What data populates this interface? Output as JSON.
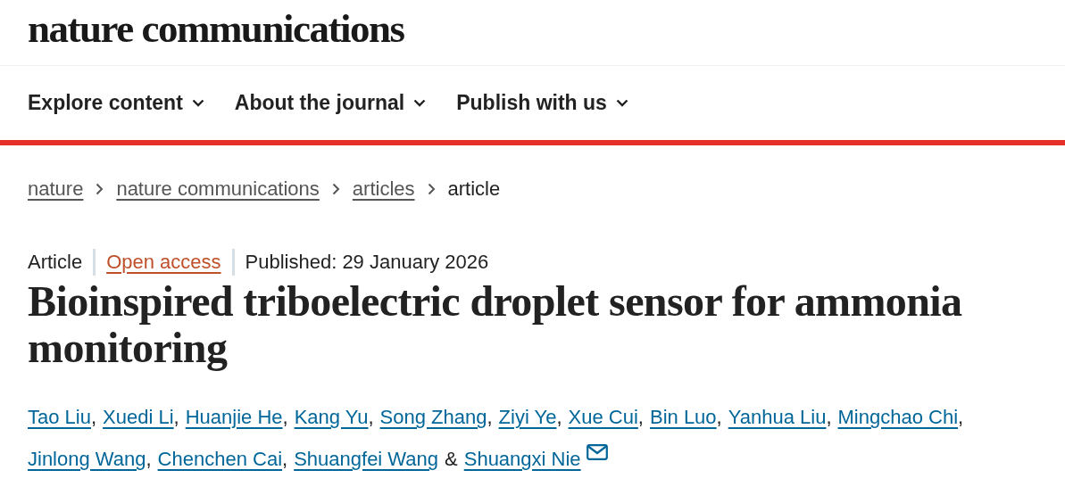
{
  "header": {
    "logo": "nature communications"
  },
  "nav": [
    {
      "label": "Explore content",
      "expanded": false
    },
    {
      "label": "About the journal",
      "expanded": false
    },
    {
      "label": "Publish with us",
      "expanded": false
    }
  ],
  "breadcrumb": [
    {
      "label": "nature",
      "current": false
    },
    {
      "label": "nature communications",
      "current": false
    },
    {
      "label": "articles",
      "current": false
    },
    {
      "label": "article",
      "current": true
    }
  ],
  "meta": [
    {
      "text": "Article",
      "kind": "type"
    },
    {
      "text": "Open access",
      "kind": "access"
    },
    {
      "text": "Published: 29 January 2026",
      "kind": "date"
    }
  ],
  "title": "Bioinspired triboelectric droplet sensor for ammonia monitoring",
  "author_lines": [
    [
      {
        "name": "Tao Liu",
        "separator": ",",
        "corresponding": false
      },
      {
        "name": "Xuedi Li",
        "separator": ",",
        "corresponding": false
      },
      {
        "name": "Huanjie He",
        "separator": ",",
        "corresponding": false
      },
      {
        "name": "Kang Yu",
        "separator": ",",
        "corresponding": false
      },
      {
        "name": "Song Zhang",
        "separator": ",",
        "corresponding": false
      },
      {
        "name": "Ziyi Ye",
        "separator": ",",
        "corresponding": false
      },
      {
        "name": "Xue Cui",
        "separator": ",",
        "corresponding": false
      },
      {
        "name": "Bin Luo",
        "separator": ",",
        "corresponding": false
      },
      {
        "name": "Yanhua Liu",
        "separator": ",",
        "corresponding": false
      },
      {
        "name": "Mingchao Chi",
        "separator": ",",
        "corresponding": false
      }
    ],
    [
      {
        "name": "Jinlong Wang",
        "separator": ",",
        "corresponding": false
      },
      {
        "name": "Chenchen Cai",
        "separator": ",",
        "corresponding": false
      },
      {
        "name": "Shuangfei Wang",
        "separator": "&",
        "corresponding": false
      },
      {
        "name": "Shuangxi Nie",
        "corresponding": true
      }
    ]
  ]
}
